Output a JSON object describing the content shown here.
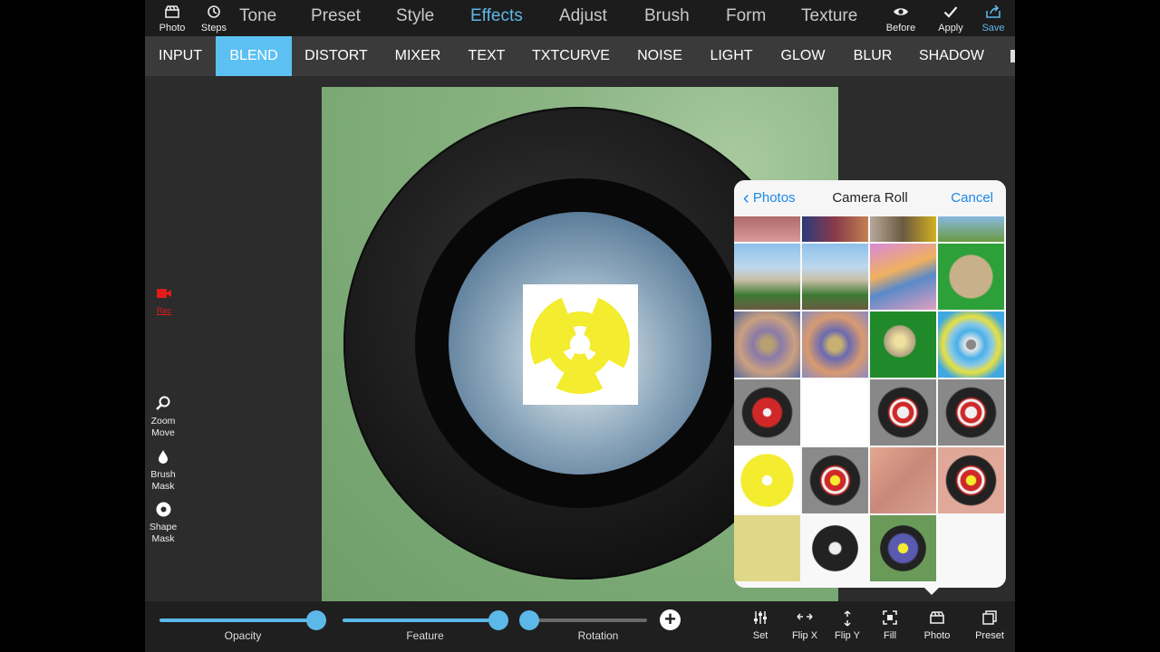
{
  "topbar": {
    "photo_label": "Photo",
    "steps_label": "Steps",
    "menus": [
      "Tone",
      "Preset",
      "Style",
      "Effects",
      "Adjust",
      "Brush",
      "Form",
      "Texture"
    ],
    "active_menu": "Effects",
    "before_label": "Before",
    "apply_label": "Apply",
    "save_label": "Save"
  },
  "effects": {
    "items": [
      "INPUT",
      "BLEND",
      "DISTORT",
      "MIXER",
      "TEXT",
      "TXTCURVE",
      "NOISE",
      "LIGHT",
      "GLOW",
      "BLUR",
      "SHADOW"
    ],
    "active": "BLEND"
  },
  "left_tools": {
    "rec_label": "Rec",
    "zoom": [
      "Zoom",
      "Move"
    ],
    "brush": [
      "Brush",
      "Mask"
    ],
    "shape": [
      "Shape",
      "Mask"
    ]
  },
  "picker": {
    "back_label": "Photos",
    "title": "Camera Roll",
    "cancel_label": "Cancel"
  },
  "bottom": {
    "opacity_label": "Opacity",
    "feature_label": "Feature",
    "rotation_label": "Rotation",
    "opacity_value": 0.99,
    "feature_value": 0.98,
    "rotation_value": 0.0,
    "set_label": "Set",
    "flipx_label": "Flip X",
    "flipy_label": "Flip Y",
    "fill_label": "Fill",
    "photo_label": "Photo",
    "preset_label": "Preset"
  },
  "colors": {
    "accent": "#5cc1f2",
    "ios_blue": "#1a88e8",
    "rec_red": "#e31b1b",
    "adapter_yellow": "#f3ec2f"
  }
}
